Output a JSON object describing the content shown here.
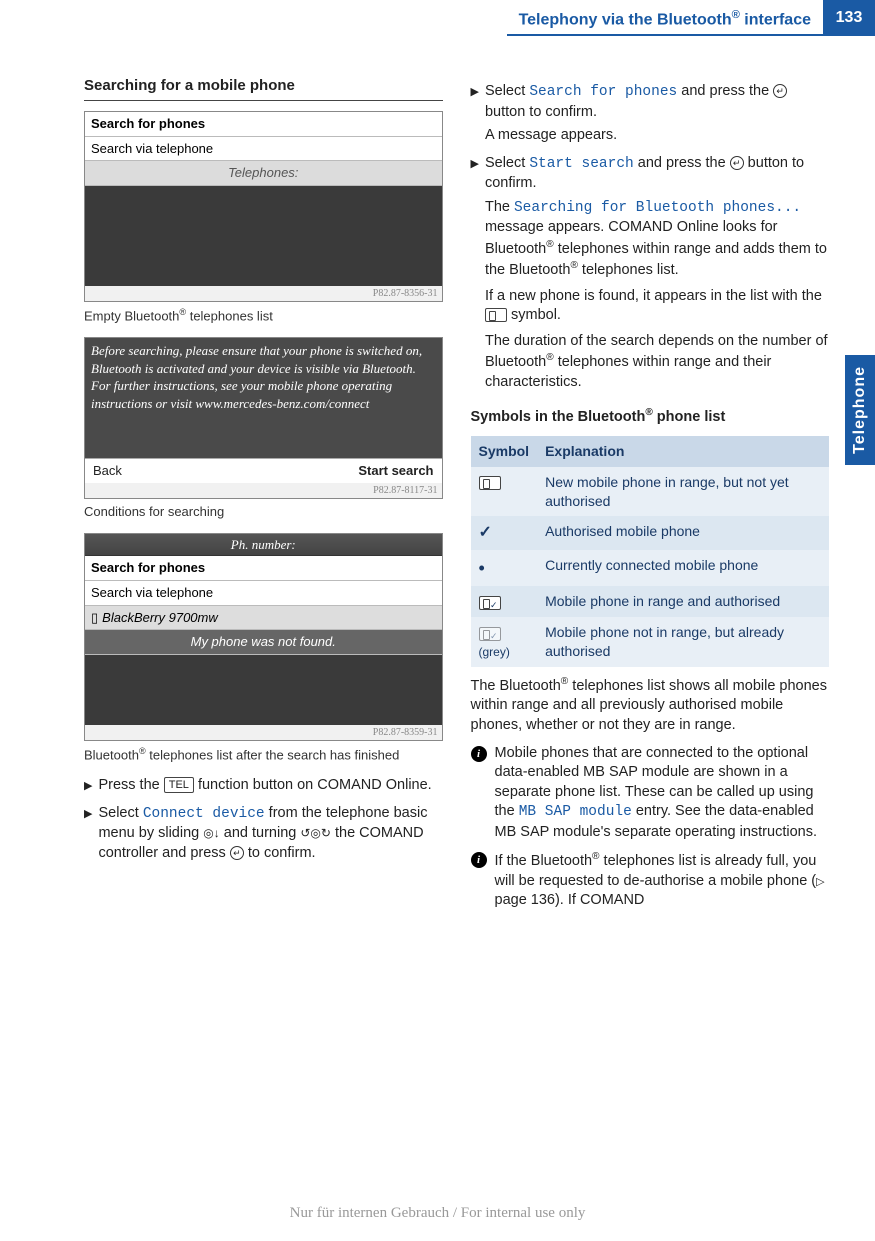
{
  "header": {
    "title_pre": "Telephony via the Bluetooth",
    "title_post": " interface",
    "page": "133"
  },
  "side_tab": "Telephone",
  "left": {
    "heading": "Searching for a mobile phone",
    "fig1": {
      "row1": "Search for phones",
      "row2": "Search via telephone",
      "phones_label": "Telephones:",
      "code": "P82.87-8356-31"
    },
    "caption1_pre": "Empty Bluetooth",
    "caption1_post": " telephones list",
    "fig2": {
      "body": "Before searching, please ensure that your phone is switched on, Bluetooth is activated and your device is visible via Bluetooth. For further instructions, see your mobile phone operating instructions or visit www.mercedes-benz.com/connect",
      "back": "Back",
      "start": "Start search",
      "code": "P82.87-8117-31"
    },
    "caption2": "Conditions for searching",
    "fig3": {
      "header": "Ph. number:",
      "row1": "Search for phones",
      "row2": "Search via telephone",
      "row3": "BlackBerry 9700mw",
      "notfound": "My phone was not found.",
      "code": "P82.87-8359-31"
    },
    "caption3_pre": "Bluetooth",
    "caption3_post": " telephones list after the search has finished",
    "step1_a": "Press the ",
    "step1_key": "TEL",
    "step1_b": " function button on COMAND Online.",
    "step2_a": "Select ",
    "step2_term": "Connect device",
    "step2_b": " from the telephone basic menu by sliding ",
    "step2_c": " and turning ",
    "step2_d": " the COMAND controller and press ",
    "step2_e": " to confirm."
  },
  "right": {
    "step3_a": "Select ",
    "step3_term": "Search for phones",
    "step3_b": " and press the ",
    "step3_c": " button to confirm.",
    "step3_d": "A message appears.",
    "step4_a": "Select ",
    "step4_term": "Start search",
    "step4_b": " and press the ",
    "step4_c": " button to confirm.",
    "step4_d1": "The ",
    "step4_term2": "Searching for Bluetooth phones...",
    "step4_d2": " message appears. COMAND Online looks for Bluetooth",
    "step4_d3": " telephones within range and adds them to the Bluetooth",
    "step4_d4": " telephones list.",
    "step4_e1": "If a new phone is found, it appears in the list with the ",
    "step4_e2": " symbol.",
    "step4_f1": "The duration of the search depends on the number of Bluetooth",
    "step4_f2": " telephones within range and their characteristics.",
    "symbols_heading_pre": "Symbols in the Bluetooth",
    "symbols_heading_post": " phone list",
    "table": {
      "h1": "Symbol",
      "h2": "Explanation",
      "r1": "New mobile phone in range, but not yet authorised",
      "r2": "Authorised mobile phone",
      "r3": "Currently connected mobile phone",
      "r4": "Mobile phone in range and authorised",
      "r5_sym": "(grey)",
      "r5": "Mobile phone not in range, but already authorised"
    },
    "para1_pre": "The Bluetooth",
    "para1_post": " telephones list shows all mobile phones within range and all previously authorised mobile phones, whether or not they are in range.",
    "info1_a": "Mobile phones that are connected to the optional data-enabled MB SAP module are shown in a separate phone list. These can be called up using the ",
    "info1_term": "MB SAP module",
    "info1_b": " entry. See the data-enabled MB SAP module's separate operating instructions.",
    "info2_a": "If the Bluetooth",
    "info2_b": " telephones list is already full, you will be requested to de-authorise a mobile phone (",
    "info2_c": " page 136). If COMAND"
  },
  "footer": "Nur für internen Gebrauch / For internal use only"
}
